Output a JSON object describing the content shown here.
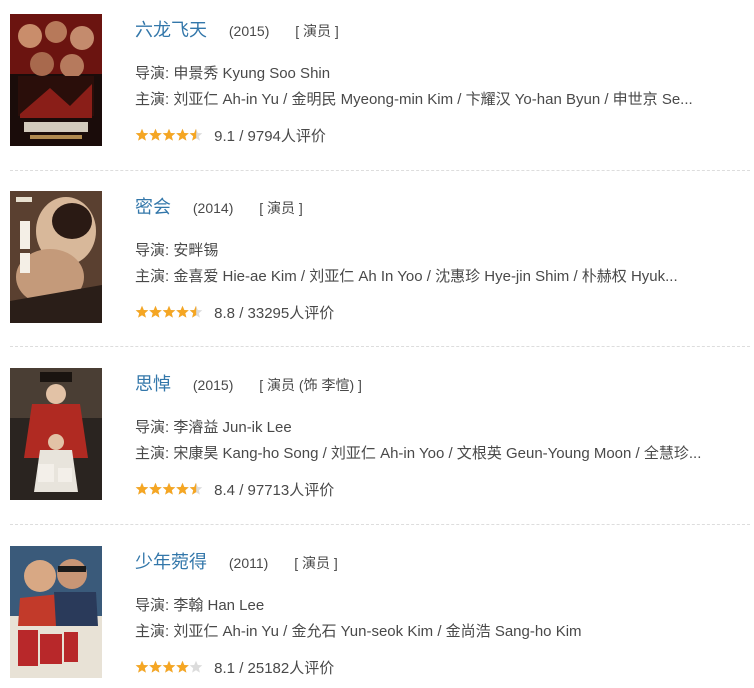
{
  "movies": [
    {
      "title": "六龙飞天",
      "year": "(2015)",
      "role": "[ 演员 ]",
      "director": "导演: 申景秀 Kyung Soo Shin",
      "cast": "主演: 刘亚仁 Ah-in Yu / 金明民 Myeong-min Kim / 卞耀汉 Yo-han Byun / 申世京 Se...",
      "rating_text": "9.1 / 9794人评价",
      "star_fraction": 0.9,
      "poster_icon": "movie-poster"
    },
    {
      "title": "密会",
      "year": "(2014)",
      "role": "[ 演员 ]",
      "director": "导演: 安畔锡",
      "cast": "主演: 金喜爱 Hie-ae Kim / 刘亚仁 Ah In Yoo / 沈惠珍 Hye-jin Shim / 朴赫权 Hyuk...",
      "rating_text": "8.8 / 33295人评价",
      "star_fraction": 0.9,
      "poster_icon": "movie-poster"
    },
    {
      "title": "思悼",
      "year": "(2015)",
      "role": "[ 演员 (饰 李愃) ]",
      "director": "导演: 李濬益 Jun-ik Lee",
      "cast": "主演: 宋康昊 Kang-ho Song / 刘亚仁 Ah-in Yoo / 文根英 Geun-Young Moon / 全慧珍...",
      "rating_text": "8.4 / 97713人评价",
      "star_fraction": 0.9,
      "poster_icon": "movie-poster"
    },
    {
      "title": "少年菀得",
      "year": "(2011)",
      "role": "[ 演员 ]",
      "director": "导演: 李翰 Han Lee",
      "cast": "主演: 刘亚仁 Ah-in Yu / 金允石 Yun-seok Kim / 金尚浩 Sang-ho Kim",
      "rating_text": "8.1 / 25182人评价",
      "star_fraction": 0.8,
      "poster_icon": "movie-poster"
    }
  ],
  "colors": {
    "title": "#3377aa",
    "text": "#494949",
    "star_on": "#f5a623",
    "star_off": "#dcdcdc",
    "separator": "#dddddd"
  }
}
